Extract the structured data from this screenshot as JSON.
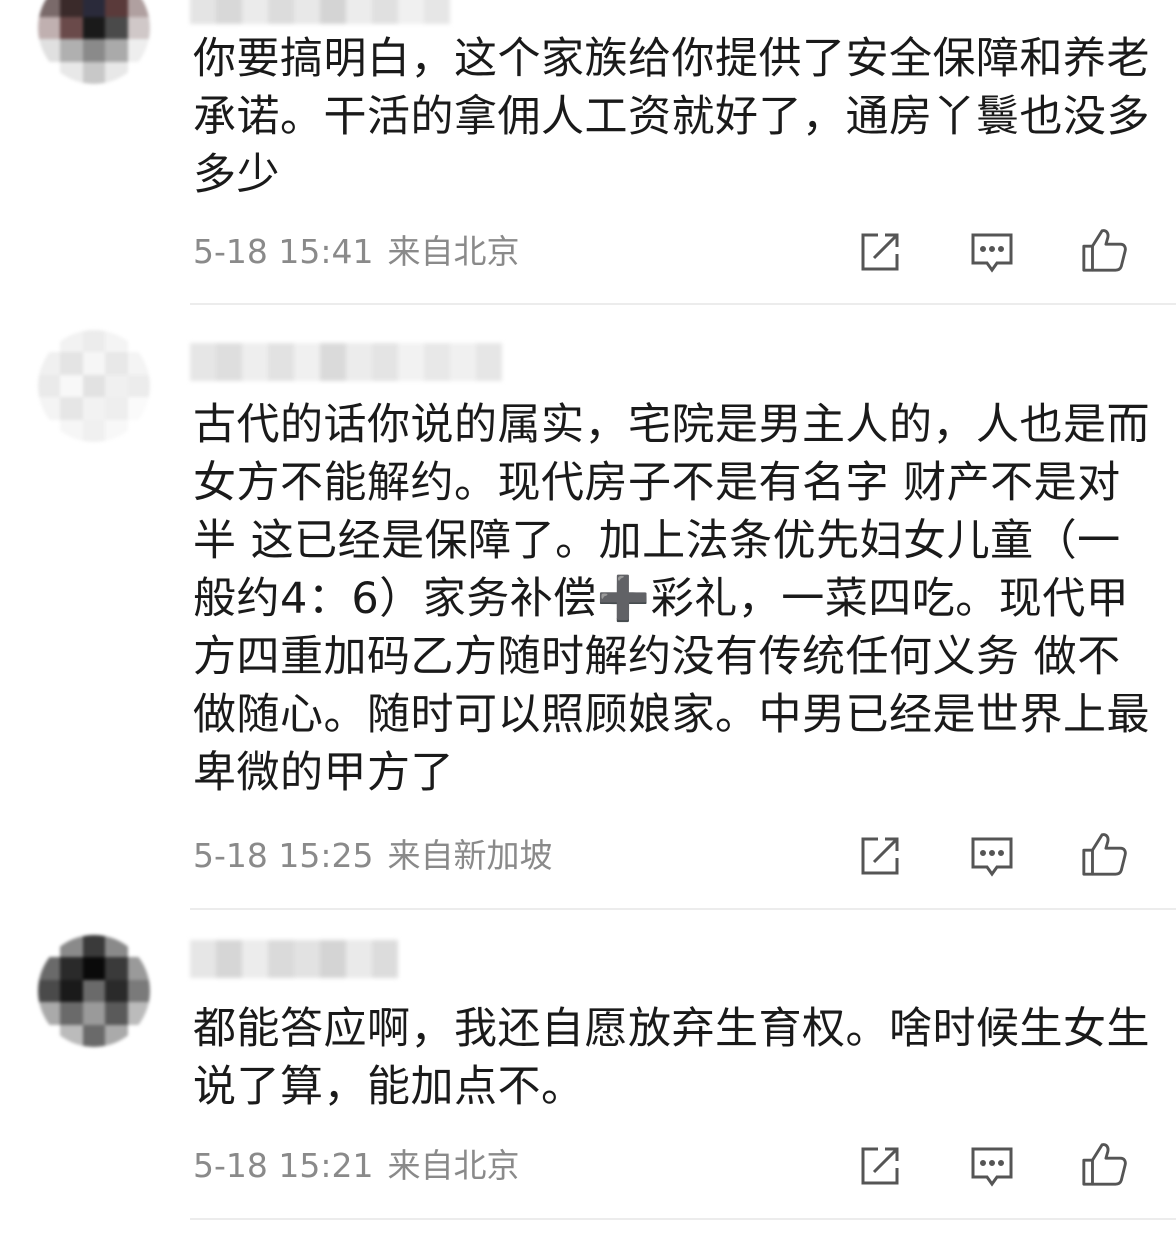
{
  "comments": [
    {
      "text": "你要搞明白，这个家族给你提供了安全保障和养老承诺。干活的拿佣人工资就好了，通房丫鬟也没多多少",
      "time": "5-18 15:41",
      "location": "来自北京"
    },
    {
      "text": "古代的话你说的属实，宅院是男主人的，人也是而女方不能解约。现代房子不是有名字 财产不是对半 这已经是保障了。加上法条优先妇女儿童（一般约4：6）家务补偿➕彩礼，一菜四吃。现代甲方四重加码乙方随时解约没有传统任何义务 做不做随心。随时可以照顾娘家。中男已经是世界上最卑微的甲方了",
      "time": "5-18 15:25",
      "location": "来自新加坡"
    },
    {
      "text": "都能答应啊，我还自愿放弃生育权。啥时候生女生说了算，能加点不。",
      "time": "5-18 15:21",
      "location": "来自北京"
    }
  ],
  "icons": {
    "share": "share-icon",
    "reply": "comment-icon",
    "like": "thumbs-up-icon"
  },
  "colors": {
    "text": "#1a1a1a",
    "meta": "#8a8a8a",
    "icon": "#555555",
    "divider": "#ececec"
  }
}
